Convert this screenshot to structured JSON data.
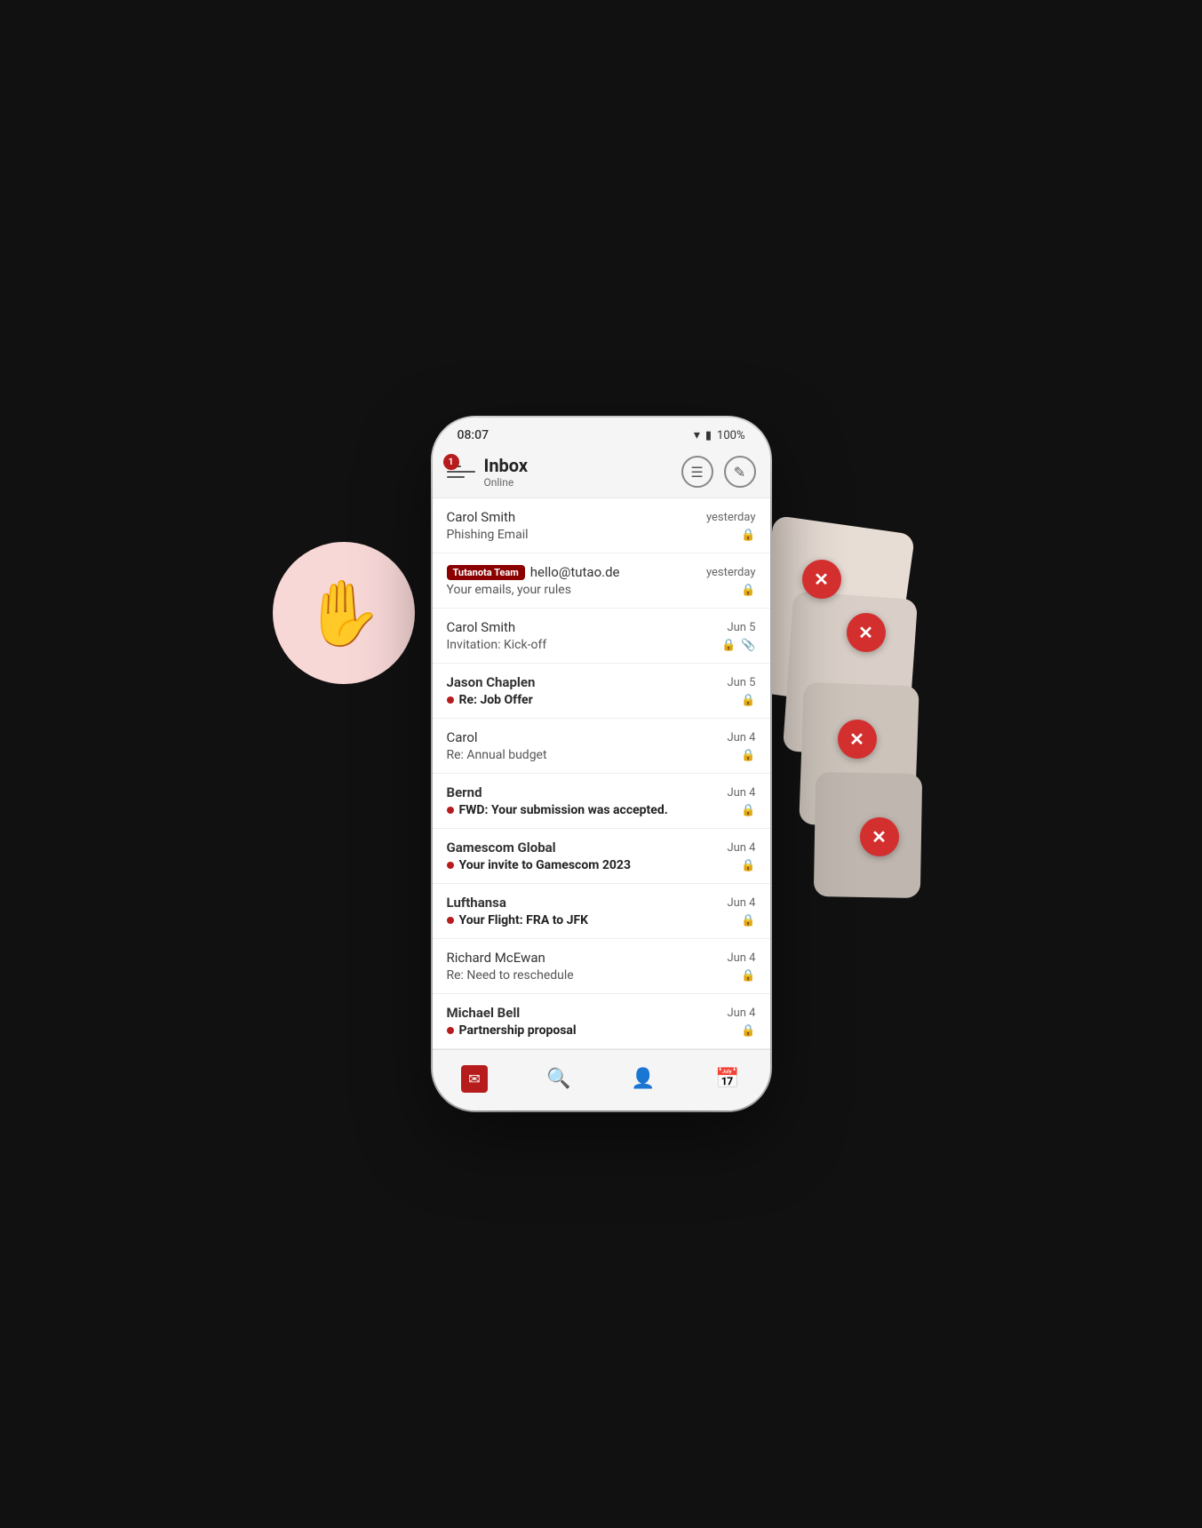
{
  "statusBar": {
    "time": "08:07",
    "battery": "100%"
  },
  "header": {
    "title": "Inbox",
    "subtitle": "Online",
    "badge": "1"
  },
  "emails": [
    {
      "id": 1,
      "sender": "Carol Smith",
      "senderBold": false,
      "date": "yesterday",
      "subject": "Phishing Email",
      "subjectBold": false,
      "unread": false,
      "hasAttachment": false,
      "hasTutanotaBadge": false
    },
    {
      "id": 2,
      "sender": "hello@tutao.de",
      "senderBold": false,
      "date": "yesterday",
      "subject": "Your emails, your rules",
      "subjectBold": false,
      "unread": false,
      "hasAttachment": false,
      "hasTutanotaBadge": true,
      "teamBadgeLabel": "Tutanota Team"
    },
    {
      "id": 3,
      "sender": "Carol Smith",
      "senderBold": false,
      "date": "Jun 5",
      "subject": "Invitation: Kick-off",
      "subjectBold": false,
      "unread": false,
      "hasAttachment": true,
      "hasTutanotaBadge": false
    },
    {
      "id": 4,
      "sender": "Jason Chaplen",
      "senderBold": true,
      "date": "Jun 5",
      "subject": "Re: Job Offer",
      "subjectBold": true,
      "unread": true,
      "hasAttachment": false,
      "hasTutanotaBadge": false
    },
    {
      "id": 5,
      "sender": "Carol",
      "senderBold": false,
      "date": "Jun 4",
      "subject": "Re: Annual budget",
      "subjectBold": false,
      "unread": false,
      "hasAttachment": false,
      "hasTutanotaBadge": false
    },
    {
      "id": 6,
      "sender": "Bernd",
      "senderBold": true,
      "date": "Jun 4",
      "subject": "FWD: Your submission was accepted.",
      "subjectBold": true,
      "unread": true,
      "hasAttachment": false,
      "hasTutanotaBadge": false
    },
    {
      "id": 7,
      "sender": "Gamescom Global",
      "senderBold": true,
      "date": "Jun 4",
      "subject": "Your invite to Gamescom 2023",
      "subjectBold": true,
      "unread": true,
      "hasAttachment": false,
      "hasTutanotaBadge": false
    },
    {
      "id": 8,
      "sender": "Lufthansa",
      "senderBold": true,
      "date": "Jun 4",
      "subject": "Your Flight: FRA to JFK",
      "subjectBold": true,
      "unread": true,
      "hasAttachment": false,
      "hasTutanotaBadge": false
    },
    {
      "id": 9,
      "sender": "Richard McEwan",
      "senderBold": false,
      "date": "Jun 4",
      "subject": "Re: Need to reschedule",
      "subjectBold": false,
      "unread": false,
      "hasAttachment": false,
      "hasTutanotaBadge": false
    },
    {
      "id": 10,
      "sender": "Michael Bell",
      "senderBold": true,
      "date": "Jun 4",
      "subject": "Partnership proposal",
      "subjectBold": true,
      "unread": true,
      "hasAttachment": false,
      "hasTutanotaBadge": false
    }
  ],
  "bottomNav": [
    {
      "icon": "envelope",
      "label": "Mail",
      "active": true
    },
    {
      "icon": "search",
      "label": "Search",
      "active": false
    },
    {
      "icon": "person",
      "label": "Contacts",
      "active": false
    },
    {
      "icon": "calendar",
      "label": "Calendar",
      "active": false
    }
  ],
  "deleteButtons": [
    {
      "id": 1,
      "topOffset": 195,
      "rightOffset": 68
    },
    {
      "id": 2,
      "topOffset": 255,
      "rightOffset": 18
    },
    {
      "id": 3,
      "topOffset": 375,
      "rightOffset": 28
    },
    {
      "id": 4,
      "topOffset": 485,
      "rightOffset": 4
    }
  ]
}
